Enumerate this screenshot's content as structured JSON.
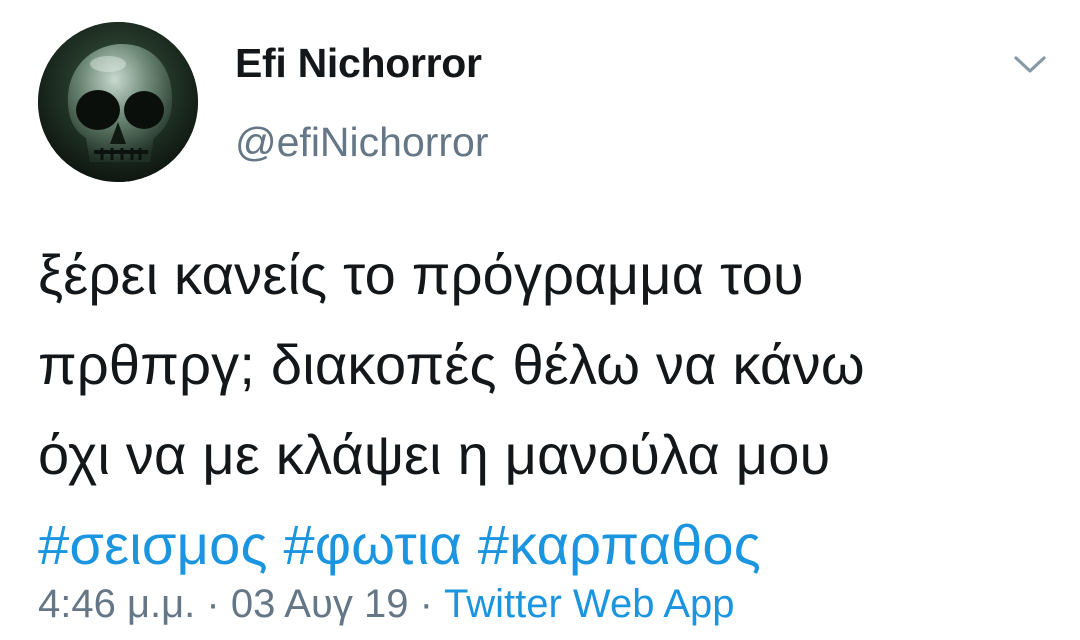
{
  "author": {
    "name": "Efi Nichorror",
    "handle": "@efiNichorror",
    "avatar_icon": "skull-avatar"
  },
  "menu": {
    "icon": "chevron-down-icon"
  },
  "tweet": {
    "lines": [
      "ξέρει κανείς το πρόγραμμα του",
      "πρθπργ; διακοπές θέλω να κάνω",
      "όχι να με κλάψει η μανούλα μου"
    ],
    "hashtags": [
      "#σεισμος",
      "#φωτια",
      "#καρπαθος"
    ]
  },
  "meta": {
    "time": "4:46 μ.μ.",
    "separator": "·",
    "date": "03 Αυγ 19",
    "source": "Twitter Web App"
  },
  "colors": {
    "text": "#14171a",
    "secondary": "#657786",
    "link": "#1b95e0"
  }
}
